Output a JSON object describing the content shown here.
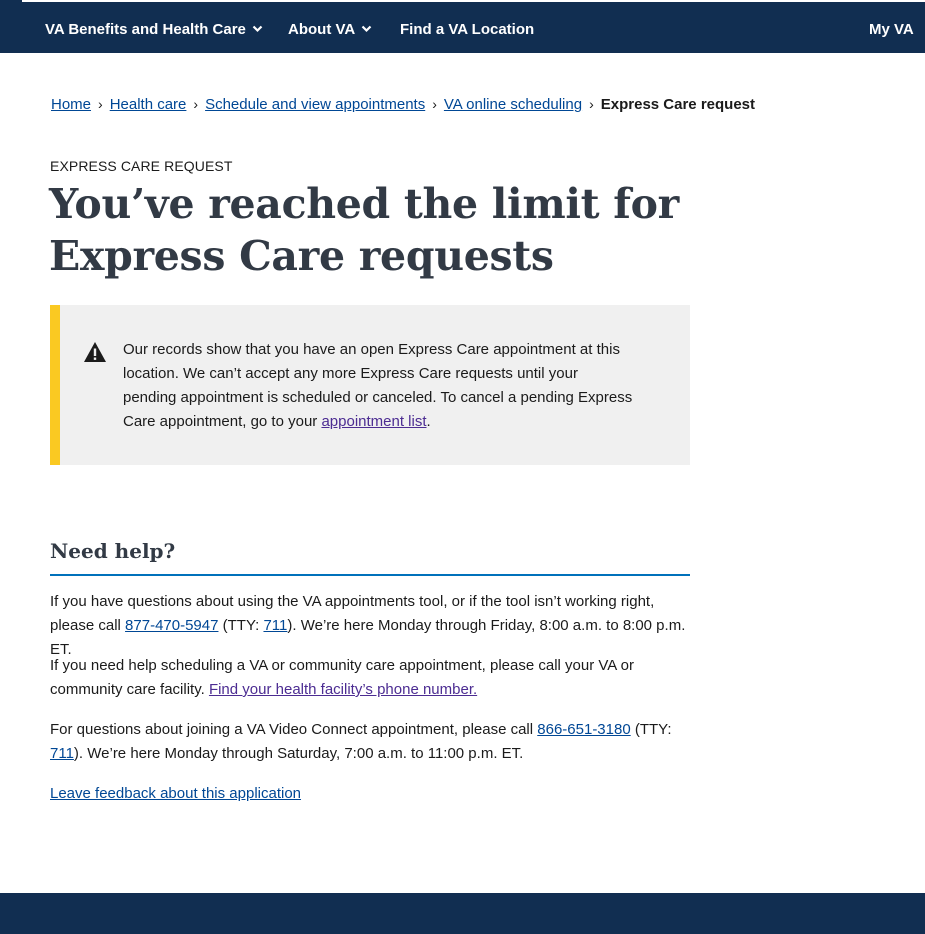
{
  "nav": {
    "benefits_label": "VA Benefits and Health Care",
    "about_label": "About VA",
    "find_label": "Find a VA Location",
    "myva_label": "My VA"
  },
  "breadcrumb": {
    "items": [
      "Home",
      "Health care",
      "Schedule and view appointments",
      "VA online scheduling"
    ],
    "current": "Express Care request",
    "separator": "›"
  },
  "page": {
    "eyebrow": "EXPRESS CARE REQUEST",
    "title_line1": "You’ve reached the limit for",
    "title_line2": "Express Care requests"
  },
  "alert": {
    "icon": "warning-icon",
    "text_before": "Our records show that you have an open Express Care appointment at this location. We can’t accept any more Express Care requests until your pending appointment is scheduled or canceled. To cancel a pending Express Care appointment, go to your ",
    "link": "appointment list",
    "text_after": ".",
    "accent_color": "#fac922"
  },
  "help": {
    "title": "Need help?",
    "p1_before": "If you have questions about using the VA appointments tool, or if the tool isn’t working right, please call ",
    "p1_phone": "877-470-5947",
    "p1_mid": " (TTY: ",
    "p1_tty": "711",
    "p1_after": "). We’re here Monday through Friday, 8:00 a.m. to 8:00 p.m. ET.",
    "p2_before": "If you need help scheduling a VA or community care appointment, please call your VA or community care facility. ",
    "p2_link": "Find your health facility’s phone number.",
    "p3_before": "For questions about joining a VA Video Connect appointment, please call ",
    "p3_phone": "866-651-3180",
    "p3_mid": " (TTY: ",
    "p3_tty": "711",
    "p3_after": "). We’re here Monday through Saturday, 7:00 a.m. to 11:00 p.m. ET.",
    "feedback_link": "Leave feedback about this application"
  },
  "colors": {
    "nav_bg": "#112e51",
    "link": "#004795",
    "visited_link": "#4c2c92",
    "rule": "#0071bb"
  }
}
